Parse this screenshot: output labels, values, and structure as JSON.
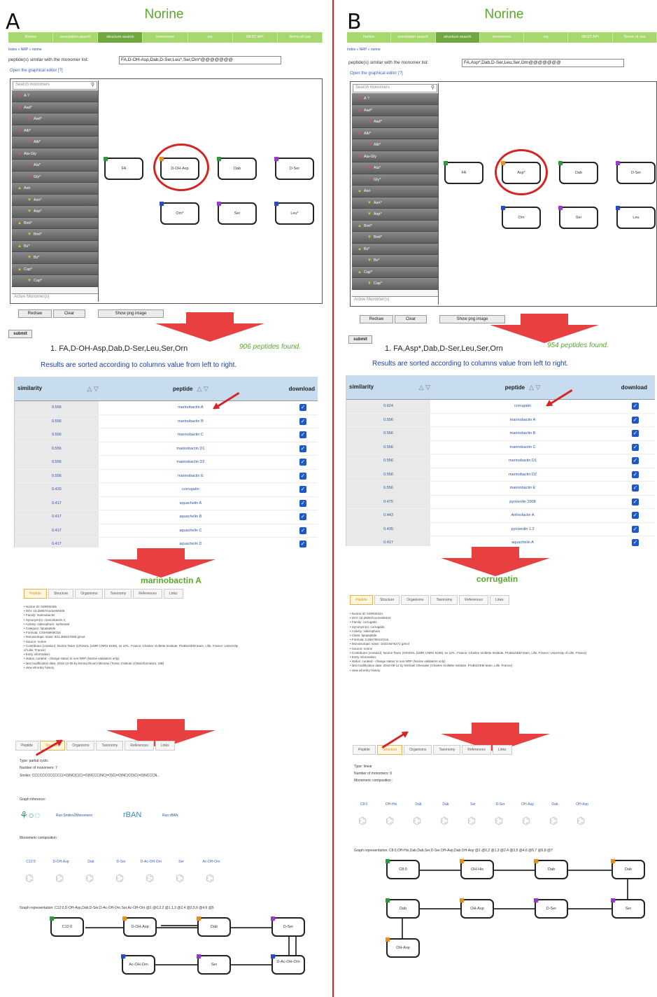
{
  "common": {
    "site_title": "Norine",
    "nav": [
      "Norine",
      "annotation search",
      "structure search",
      "monomers",
      "my",
      "REST API",
      "Terms of use"
    ],
    "breadcrumb": "Index » NRP » norine",
    "graph_editor_link": "Open the graphical editor [?]",
    "search_monomers_placeholder": "Search monomers",
    "active_monomers": "Active Monomer(s)",
    "monomer_groups": [
      {
        "g": "A ?",
        "c": []
      },
      {
        "g": "Aad*",
        "c": [
          "Aad*"
        ]
      },
      {
        "g": "Alb*",
        "c": [
          "Alb*"
        ]
      },
      {
        "g": "Ala-Gly",
        "c": [
          "Ala*",
          "Gly*"
        ]
      },
      {
        "g": "Asn",
        "c": [
          "Asn*",
          "Asp*"
        ]
      },
      {
        "g": "Bmt*",
        "c": [
          "Bmt*"
        ]
      },
      {
        "g": "Bz*",
        "c": [
          "Bz*"
        ]
      },
      {
        "g": "Cap*",
        "c": [
          "Cap*"
        ]
      }
    ],
    "redraw": "Redraw",
    "clear": "Clear",
    "show_png": "Show png image",
    "submit": "submit",
    "sorted_text": "Results are sorted according to columns value from left to right.",
    "col_similarity": "similarity",
    "col_peptide": "peptide",
    "col_download": "download",
    "detail_tabs": [
      "Peptide",
      "Structure",
      "Organisms",
      "Taxonomy",
      "References",
      "Links"
    ],
    "colors": {
      "green": "#5aa82a",
      "nav": "#a6d86e",
      "red": "#e02020",
      "link": "#2a50a8"
    }
  },
  "panelA": {
    "letter": "A",
    "similar_label": "peptide(s) similar with the monomer list:",
    "monomer_list": "FA,D-OH-Asp,Dab,D-Ser,Leu*,Ser,Orn*@@@@@@@",
    "graph_nodes": [
      "FA",
      "D-OH-Asp",
      "Dab",
      "D-Ser",
      "Orn*",
      "Ser",
      "Leu*"
    ],
    "query_title": "1. FA,D-OH-Asp,Dab,D-Ser,Leu,Ser,Orn",
    "found": "906 peptides found.",
    "rows": [
      [
        "0.556",
        "marinobactin A"
      ],
      [
        "0.556",
        "marinobactin B"
      ],
      [
        "0.556",
        "marinobactin C"
      ],
      [
        "0.556",
        "marinobactin D1"
      ],
      [
        "0.556",
        "marinobactin D2"
      ],
      [
        "0.556",
        "marinobactin E"
      ],
      [
        "0.420",
        "corrugatin"
      ],
      [
        "0.417",
        "aquachelin A"
      ],
      [
        "0.417",
        "aquachelin B"
      ],
      [
        "0.417",
        "aquachelin C"
      ],
      [
        "0.417",
        "aquachelin D"
      ]
    ],
    "peptide_name": "marinobactin A",
    "info": [
      "Norine ID: NOR00405",
      "DOI: 10.26057/norine00405",
      "Family: marinobactin",
      "Synonym(s): marinobactin A;",
      "Activity: siderophore; surfactant",
      "Category: lipopeptide",
      "Formula: C40H69N9O16",
      "Monoisotopic mass: 931.486227065 g/mol",
      "Source: norine",
      "Contributor (creation): Norine Team (CRIStAL (UMR CNRS 9189), ex LIFL, France; Charles Viollette Institute, ProBioGEM team, Lille, France; University of Lille, France)",
      "Entry information:",
      "status: curated - change status to non-NRP (Norine validators only)",
      "last modification date: 2018-12-05 by Emma Ricart Altimiras (Tonsic Institute of Bioinformatics, SIB)",
      "view all entry history"
    ],
    "structure": {
      "type": "Type: partial cyclic",
      "num_monomers": "Number of monomers: 7",
      "smiles": "Smiles: CCCCCCCCCCCC(=O)NC(C(C(=O)NCCC(NC(=O)C(=O)NC(CO)C(=O)NCCCN...",
      "graph_inference": "Graph inference:",
      "tool1": "Run Smiles2Monomers",
      "tool2": "rBAN",
      "tool3": "Run rBAN",
      "composition_label": "Monomeric composition :",
      "composition": [
        "C12:0",
        "D-OH-Asp",
        "Dab",
        "D-Ser",
        "D-Ac-OH-Orn",
        "Ser",
        "Ac-OH-Orn"
      ],
      "graph_rep": "Graph representation: C12:0,D-OH-Asp,Dab,D-Ser,D-Ac-OH-Orn,Ser,Ac-OH-Orn @1 @0,2,2 @1,1,3 @2,4 @3,5,6 @4,6 @5",
      "graph": [
        "C12:0",
        "D-OH-Asp",
        "Dab",
        "D-Ser",
        "Ac-OH-Orn",
        "Ser",
        "D-Ac-OH-Orn"
      ]
    }
  },
  "panelB": {
    "letter": "B",
    "similar_label": "peptide(s) similar with the monomer list:",
    "monomer_list": "FA,Asp*,Dab,D-Ser,Leu,Ser,Orn@@@@@@@",
    "graph_nodes": [
      "FA",
      "Asp*",
      "Dab",
      "D-Ser",
      "Orn",
      "Ser",
      "Leu"
    ],
    "query_title": "1. FA,Asp*,Dab,D-Ser,Leu,Ser,Orn",
    "found": "954 peptides found.",
    "rows": [
      [
        "0.624",
        "corrugatin"
      ],
      [
        "0.556",
        "marinobactin A"
      ],
      [
        "0.556",
        "marinobactin B"
      ],
      [
        "0.556",
        "marinobactin C"
      ],
      [
        "0.556",
        "marinobactin D1"
      ],
      [
        "0.556",
        "marinobactin D2"
      ],
      [
        "0.556",
        "marinobactin E"
      ],
      [
        "0.475",
        "pyoverdin 2908"
      ],
      [
        "0.443",
        "Arthrofactin A"
      ],
      [
        "0.435",
        "pyoverdin 1.2"
      ],
      [
        "0.417",
        "aquachelin A"
      ]
    ],
    "peptide_name": "corrugatin",
    "info": [
      "Norine ID: NOR00424",
      "DOI: 10.26057/norine00424",
      "Family: corrugatin",
      "Synonym(s): corrugatin;",
      "Activity: siderophore",
      "Class: lipopeptide",
      "Formula: C45H76N12O16",
      "Monoisotopic mass: 1033.5676271 g/mol",
      "Source: norine",
      "Contributor (creation): Norine Team (CRIStAL (UMR CNRS 9189), ex LIFL, France; Charles Viollette Institute, ProBioGEM team, Lille, France; University of Lille, France)",
      "Entry information:",
      "status: curated - change status to non-NRP (Norine validators only)",
      "last modification date: 2018-09-12 by Michael Chevalier (Charles Viollette Institute, ProBioGEM team, Lille, France)",
      "view all entry history"
    ],
    "structure": {
      "type": "Type: linear",
      "num_monomers": "Number of monomers: 9",
      "composition_label": "Monomeric composition :",
      "composition": [
        "C8:0",
        "OH-His",
        "Dab",
        "Dab",
        "Ser",
        "D-Ser",
        "OH-Asp",
        "Dab",
        "OH-Asp"
      ],
      "graph_rep": "Graph representation: C8:0,OH-His,Dab,Dab,Ser,D-Ser,OH-Asp,Dab,OH-Asp @1 @0,2 @1,3 @2,4 @3,5 @4,6 @5,7 @6,8 @7",
      "graph": [
        "C8:0",
        "OH-His",
        "Dab",
        "Dab",
        "Dab",
        "OH-Asp",
        "D-Ser",
        "Ser",
        "OH-Asp"
      ]
    }
  }
}
